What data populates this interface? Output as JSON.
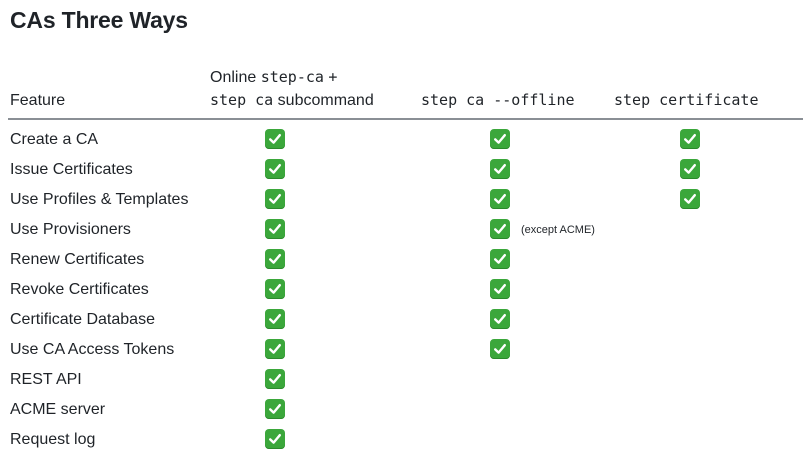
{
  "title": "CAs Three Ways",
  "columns": {
    "feature": "Feature",
    "online_text": "Online",
    "online_code1": "step-ca",
    "online_plus": "+",
    "online_code2": "step ca",
    "online_sub": "subcommand",
    "offline_code": "step ca --offline",
    "certificate_code": "step certificate"
  },
  "check_icon": "white-check-mark-icon",
  "accent_color": "#3ba73b",
  "rows": [
    {
      "feature": "Create a CA",
      "online": true,
      "offline": true,
      "certificate": true
    },
    {
      "feature": "Issue Certificates",
      "online": true,
      "offline": true,
      "certificate": true
    },
    {
      "feature": "Use Profiles & Templates",
      "online": true,
      "offline": true,
      "certificate": true
    },
    {
      "feature": "Use Provisioners",
      "online": true,
      "offline": true,
      "certificate": false,
      "offline_note": "(except ACME)"
    },
    {
      "feature": "Renew Certificates",
      "online": true,
      "offline": true,
      "certificate": false
    },
    {
      "feature": "Revoke Certificates",
      "online": true,
      "offline": true,
      "certificate": false
    },
    {
      "feature": "Certificate Database",
      "online": true,
      "offline": true,
      "certificate": false
    },
    {
      "feature": "Use CA Access Tokens",
      "online": true,
      "offline": true,
      "certificate": false
    },
    {
      "feature": "REST API",
      "online": true,
      "offline": false,
      "certificate": false
    },
    {
      "feature": "ACME server",
      "online": true,
      "offline": false,
      "certificate": false
    },
    {
      "feature": "Request log",
      "online": true,
      "offline": false,
      "certificate": false
    }
  ]
}
